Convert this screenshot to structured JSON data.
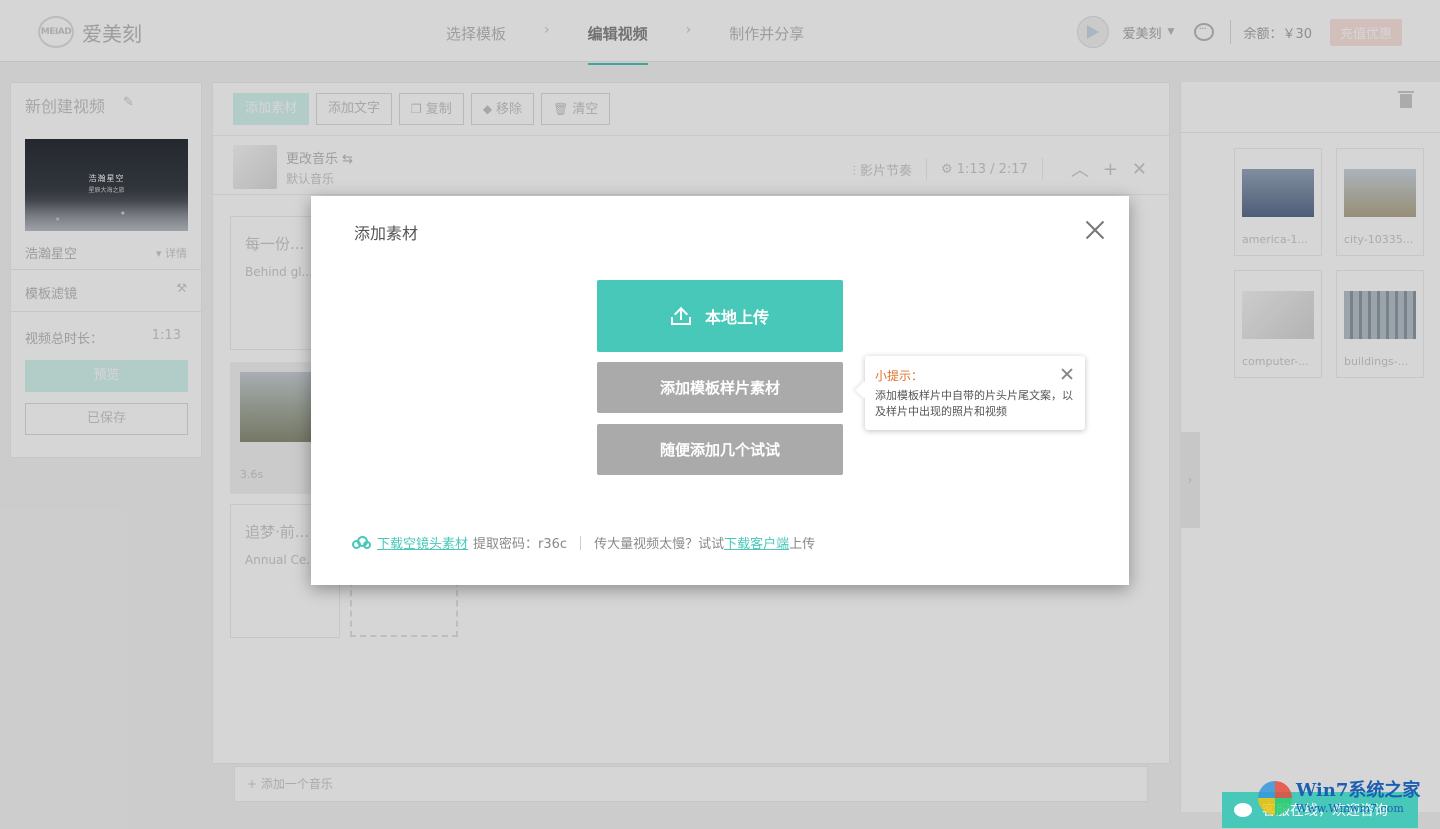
{
  "header": {
    "brand_badge": "MEIAD",
    "brand": "爱美刻",
    "steps": [
      {
        "label": "选择模板"
      },
      {
        "label": "编辑视频"
      },
      {
        "label": "制作并分享"
      }
    ],
    "username": "爱美刻",
    "balance": "余额：￥30",
    "recharge": "充值优惠"
  },
  "left_panel": {
    "title": "新创建视频",
    "thumb_title": "浩瀚星空",
    "thumb_sub": "星辰大海之旅",
    "template_name": "浩瀚星空",
    "detail": "▾ 详情",
    "filter": "模板滤镜",
    "duration_label": "视频总时长：",
    "duration_value": "1:13",
    "preview": "预览",
    "saved": "已保存"
  },
  "toolbar": {
    "add_material": "添加素材",
    "add_text": "添加文字",
    "copy": "复制",
    "remove": "移除",
    "clear": "清空"
  },
  "music": {
    "change": "更改音乐 ⇆",
    "default": "默认音乐",
    "rhythm": "影片节奏",
    "time": "1:13 / 2:17"
  },
  "cards": [
    {
      "title": "每一份...",
      "sub": "Behind gl..."
    },
    {
      "title": "追梦·前...",
      "sub": "Annual Ce..."
    }
  ],
  "clip": {
    "duration": "3.6s"
  },
  "add_music": "+ 添加一个音乐",
  "media": [
    {
      "label": "america-1...",
      "color": "#7d8fa6"
    },
    {
      "label": "city-10335...",
      "color": "#b7b4a0"
    },
    {
      "label": "computer-...",
      "color": "#e6e6e6"
    },
    {
      "label": "buildings-...",
      "color": "#a9b5bf"
    }
  ],
  "modal": {
    "title": "添加素材",
    "upload": "本地上传",
    "add_template": "添加模板样片素材",
    "random": "随便添加几个试试",
    "tip_title": "小提示：",
    "tip_body": "添加模板样片中自带的片头片尾文案，以及样片中出现的照片和视频",
    "footer": {
      "download_link": "下载空镜头素材",
      "code": "提取密码：r36c",
      "slow": "传大量视频太慢？试试",
      "client_link": "下载客户端",
      "upload_suffix": "上传"
    }
  },
  "float_chat": "客服在线，欢迎咨询",
  "watermark": {
    "main": "Win7系统之家",
    "url": "Www.Winwin7.com"
  }
}
